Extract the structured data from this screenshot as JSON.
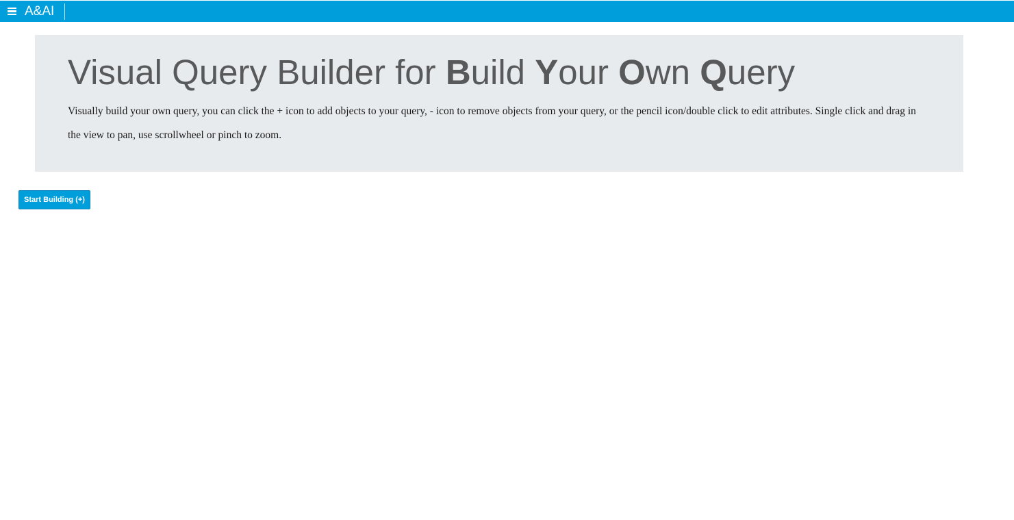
{
  "header": {
    "brand": "A&AI",
    "background_color": "#009edb",
    "menu_icon": "hamburger-menu-icon"
  },
  "jumbotron": {
    "title_parts": {
      "p1": "Visual Query Builder for ",
      "b1": "B",
      "p2": "uild ",
      "b2": "Y",
      "p3": "our ",
      "b3": "O",
      "p4": "wn ",
      "b4": "Q",
      "p5": "uery"
    },
    "description": "Visually build your own query, you can click the + icon to add objects to your query, - icon to remove objects from your query, or the pencil icon/double click to edit attributes. Single click and drag in the view to pan, use scrollwheel or pinch to zoom.",
    "background_color": "#e8ebee"
  },
  "actions": {
    "start_button_label": "Start Building (+)",
    "accent_color": "#009edb"
  }
}
